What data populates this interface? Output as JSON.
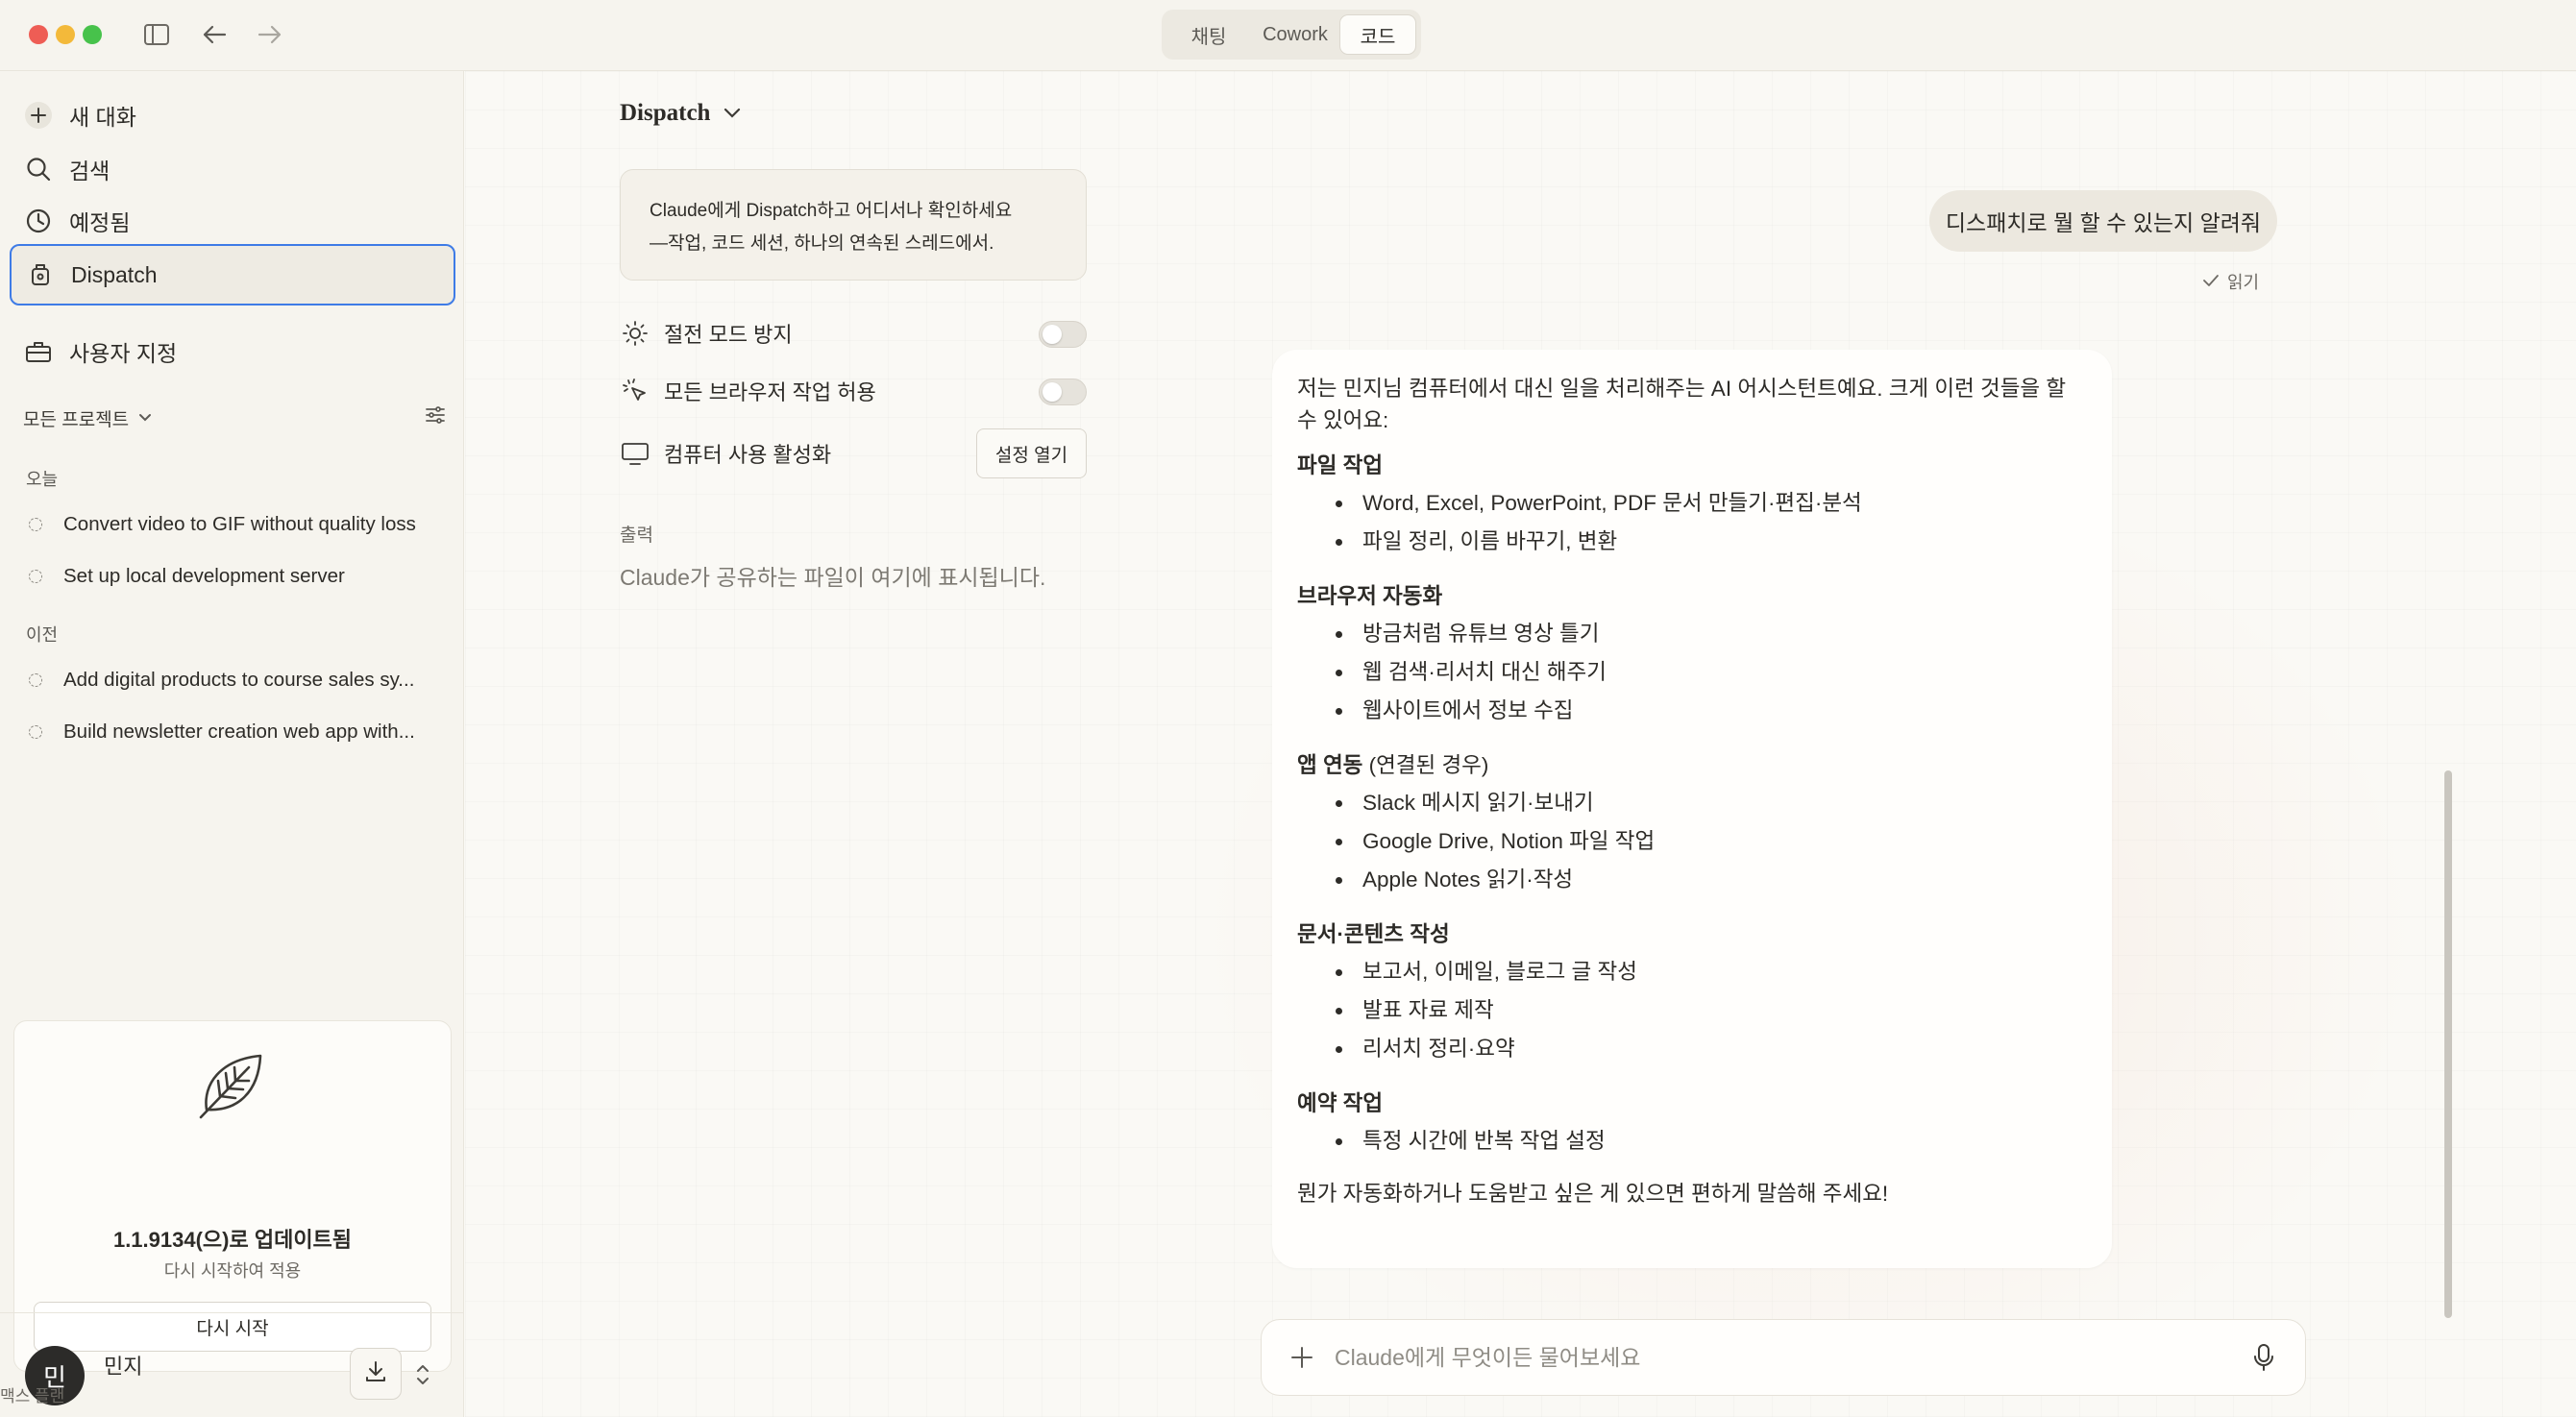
{
  "window": {
    "mode_tabs": [
      {
        "label": "채팅"
      },
      {
        "label": "Cowork"
      },
      {
        "label": "코드"
      }
    ]
  },
  "sidebar": {
    "nav": [
      {
        "label": "새 대화",
        "icon": "plus-icon"
      },
      {
        "label": "검색",
        "icon": "search-icon"
      },
      {
        "label": "예정됨",
        "icon": "clock-icon"
      },
      {
        "label": "Dispatch",
        "icon": "dispatch-icon"
      },
      {
        "label": "사용자 지정",
        "icon": "toolbox-icon"
      }
    ],
    "projects_label": "모든 프로젝트",
    "today_label": "오늘",
    "today_items": [
      {
        "title": "Convert video to GIF without quality loss"
      },
      {
        "title": "Set up local development server"
      }
    ],
    "previous_label": "이전",
    "previous_items": [
      {
        "title": "Add digital products to course sales sy..."
      },
      {
        "title": "Build newsletter creation web app with..."
      }
    ],
    "update": {
      "title": "1.1.9134(으)로 업데이트됨",
      "subtitle": "다시 시작하여 적용",
      "button": "다시 시작"
    },
    "user": {
      "initial": "민",
      "name": "민지",
      "plan": "맥스 플랜"
    }
  },
  "dispatch_panel": {
    "title": "Dispatch",
    "info_line1": "Claude에게 Dispatch하고 어디서나 확인하세요",
    "info_line2": "—작업, 코드 세션, 하나의 연속된 스레드에서.",
    "settings": [
      {
        "label": "절전 모드 방지",
        "type": "toggle",
        "on": false
      },
      {
        "label": "모든 브라우저 작업 허용",
        "type": "toggle",
        "on": false
      },
      {
        "label": "컴퓨터 사용 활성화",
        "type": "button",
        "button_label": "설정 열기"
      }
    ],
    "output_label": "출력",
    "output_empty": "Claude가 공유하는 파일이 여기에 표시됩니다."
  },
  "chat": {
    "user_message": "디스패치로 뭘 할 수 있는지 알려줘",
    "read_status": "읽기",
    "reply": {
      "intro": "저는 민지님 컴퓨터에서 대신 일을 처리해주는 AI 어시스턴트예요. 크게 이런 것들을 할 수 있어요:",
      "sections": [
        {
          "heading": "파일 작업",
          "heading_note": "",
          "items": [
            "Word, Excel, PowerPoint, PDF 문서 만들기·편집·분석",
            "파일 정리, 이름 바꾸기, 변환"
          ]
        },
        {
          "heading": "브라우저 자동화",
          "heading_note": "",
          "items": [
            "방금처럼 유튜브 영상 틀기",
            "웹 검색·리서치 대신 해주기",
            "웹사이트에서 정보 수집"
          ]
        },
        {
          "heading": "앱 연동",
          "heading_note": " (연결된 경우)",
          "items": [
            "Slack 메시지 읽기·보내기",
            "Google Drive, Notion 파일 작업",
            "Apple Notes 읽기·작성"
          ]
        },
        {
          "heading": "문서·콘텐츠 작성",
          "heading_note": "",
          "items": [
            "보고서, 이메일, 블로그 글 작성",
            "발표 자료 제작",
            "리서치 정리·요약"
          ]
        },
        {
          "heading": "예약 작업",
          "heading_note": "",
          "items": [
            "특정 시간에 반복 작업 설정"
          ]
        }
      ],
      "closing": "뭔가 자동화하거나 도움받고 싶은 게 있으면 편하게 말씀해 주세요!"
    },
    "composer_placeholder": "Claude에게 무엇이든 물어보세요"
  }
}
